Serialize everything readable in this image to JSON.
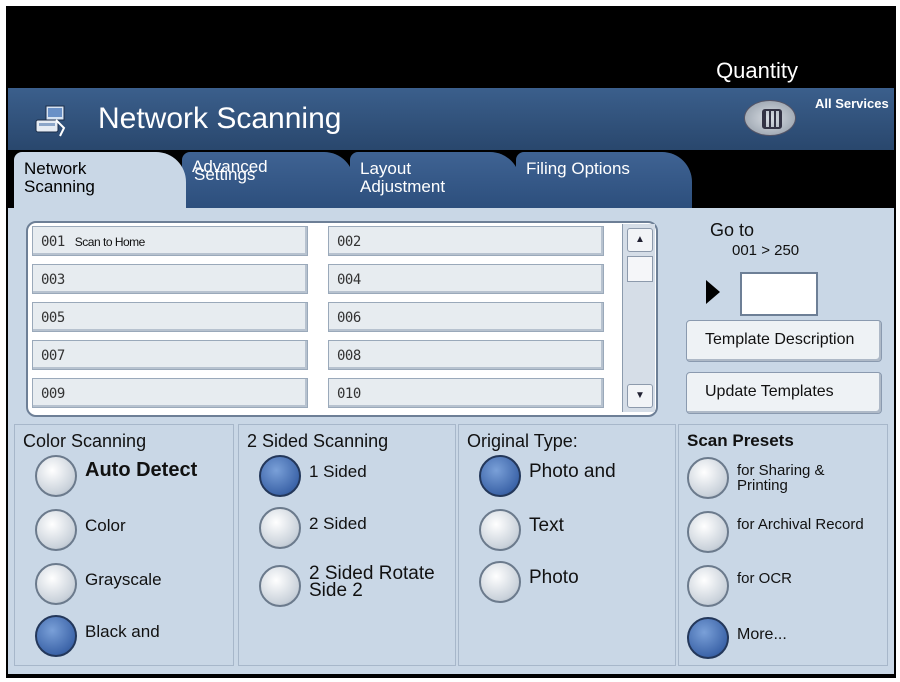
{
  "header": {
    "quantity_label": "Quantity",
    "title": "Network Scanning",
    "all_services_label": "All Services"
  },
  "tabs": [
    {
      "label_line1": "Network",
      "label_line2": "Scanning",
      "active": true
    },
    {
      "label_line1": "Advanced",
      "label_line2": "Settings",
      "active": false
    },
    {
      "label_line1": "Layout",
      "label_line2": "Adjustment",
      "active": false
    },
    {
      "label_line1": "Filing Options",
      "label_line2": "",
      "active": false
    }
  ],
  "templates": [
    {
      "num": "001",
      "name": "Scan to Home"
    },
    {
      "num": "002",
      "name": ""
    },
    {
      "num": "003",
      "name": ""
    },
    {
      "num": "004",
      "name": ""
    },
    {
      "num": "005",
      "name": ""
    },
    {
      "num": "006",
      "name": ""
    },
    {
      "num": "007",
      "name": ""
    },
    {
      "num": "008",
      "name": ""
    },
    {
      "num": "009",
      "name": ""
    },
    {
      "num": "010",
      "name": ""
    }
  ],
  "goto": {
    "label": "Go to",
    "range": "001 > 250",
    "value": ""
  },
  "side_buttons": {
    "template_description": "Template Description",
    "update_templates": "Update Templates"
  },
  "color_scanning": {
    "title": "Color Scanning",
    "options": [
      {
        "label": "Auto Detect",
        "selected": false
      },
      {
        "label": "Color",
        "selected": false
      },
      {
        "label": "Grayscale",
        "selected": false
      },
      {
        "label": "Black and",
        "selected": true
      }
    ]
  },
  "two_sided": {
    "title": "2 Sided Scanning",
    "options": [
      {
        "label": "1 Sided",
        "selected": true
      },
      {
        "label": "2 Sided",
        "selected": false
      },
      {
        "label": "2 Sided Rotate Side 2",
        "selected": false
      }
    ]
  },
  "original_type": {
    "title": "Original Type:",
    "options": [
      {
        "label": "Photo and",
        "selected": true
      },
      {
        "label": "Text",
        "selected": false
      },
      {
        "label": "Photo",
        "selected": false
      }
    ]
  },
  "scan_presets": {
    "title": "Scan Presets",
    "options": [
      {
        "label": "for Sharing & Printing",
        "selected": false
      },
      {
        "label": "for Archival Record",
        "selected": false
      },
      {
        "label": "for OCR",
        "selected": false
      },
      {
        "label": "More...",
        "selected": true
      }
    ]
  },
  "colors": {
    "header_blue": "#2f5280",
    "panel_bg": "#c9d7e6",
    "radio_selected": "#3e66aa"
  }
}
